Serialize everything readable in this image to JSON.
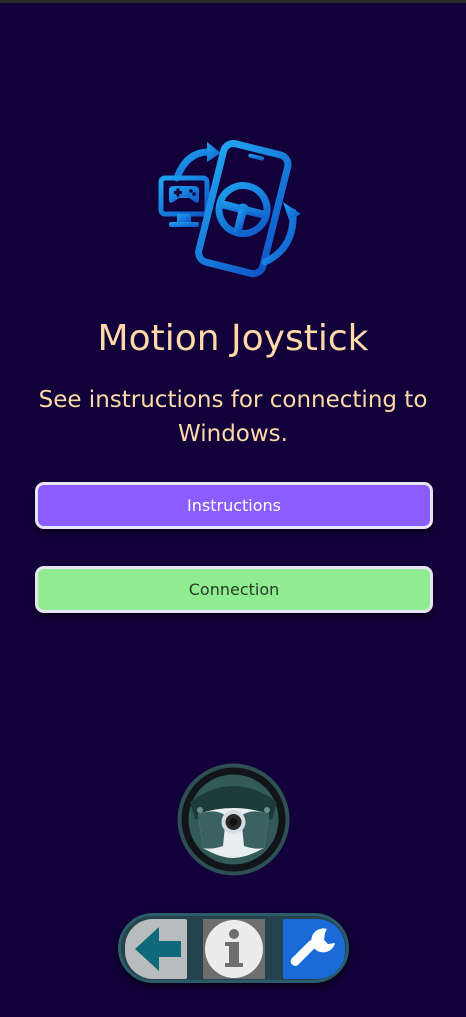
{
  "app": {
    "title": "Motion Joystick",
    "subtitle": "See instructions for connecting to Windows."
  },
  "buttons": {
    "instructions_label": "Instructions",
    "connection_label": "Connection"
  },
  "icons": {
    "logo": "phone-steering-wheel-gamepad-icon",
    "wheel_button": "steering-wheel-icon",
    "back": "arrow-left-icon",
    "info": "info-icon",
    "settings": "wrench-icon"
  },
  "colors": {
    "background": "#12003a",
    "text_accent": "#ffd9a8",
    "instructions_button": "#8b5cff",
    "connection_button": "#90ec90",
    "logo_blue": "#1a8ee8"
  }
}
